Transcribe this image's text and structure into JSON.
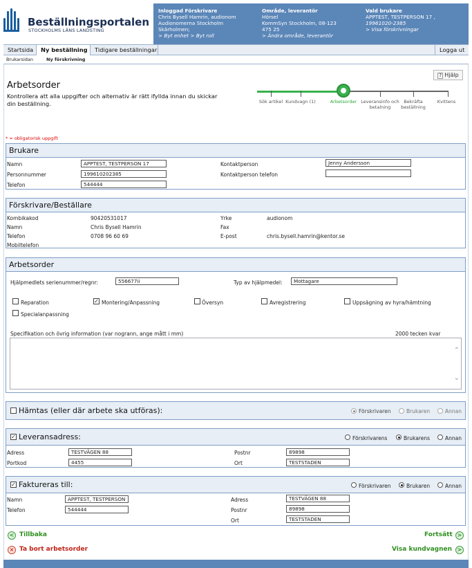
{
  "header": {
    "logo_title": "Beställningsportalen",
    "logo_subtitle": "STOCKHOLMS LÄNS LANDSTING",
    "logged_in": {
      "title": "Inloggad Förskrivare",
      "line1": "Chris Bysell Hamrin, audionom",
      "line2": "Audionomerna Stockholm",
      "line3": "Skärholmen;",
      "link": "> Byt enhet > Byt roll"
    },
    "area": {
      "title": "Område, leverantör",
      "line1": "Hörsel",
      "line2": "KommSyn Stockholm, 08-123",
      "line3": "475 25",
      "link": "> Ändra område, leverantör"
    },
    "user": {
      "title": "Vald brukare",
      "line1": "APPTEST, TESTPERSON 17 ,",
      "line2": "19961020-2385",
      "link": "> Visa förskrivningar"
    },
    "accent_color": "#5b86b8"
  },
  "nav": {
    "tabs": [
      "Startsida",
      "Ny beställning",
      "Tidigare beställningar"
    ],
    "logout": "Logga ut",
    "sub": [
      "Brukarsidan",
      "Ny förskrivning"
    ]
  },
  "page": {
    "help": "Hjälp",
    "title": "Arbetsorder",
    "description": "Kontrollera att alla uppgifter och alternativ är rätt ifyllda innan du skickar din beställning.",
    "required_note": "* = obligatorisk uppgift",
    "steps": [
      {
        "label": "Sök artikel"
      },
      {
        "label": "Kundvagn (1)"
      },
      {
        "label": "Arbetsorder"
      },
      {
        "label": "Leveransinfo och betalning"
      },
      {
        "label": "Bekräfta beställning"
      },
      {
        "label": "Kvittens"
      }
    ]
  },
  "brukare": {
    "heading": "Brukare",
    "name_label": "Namn",
    "name_value": "APPTEST, TESTPERSON 17",
    "pnr_label": "Personnummer",
    "pnr_value": "199610202385",
    "phone_label": "Telefon",
    "phone_value": "544444",
    "contact_label": "Kontaktperson",
    "contact_value": "Jenny Andersson",
    "contact_phone_label": "Kontaktperson telefon",
    "contact_phone_value": ""
  },
  "forskrivare": {
    "heading": "Förskrivare/Beställare",
    "kombi_label": "Kombikakod",
    "kombi_value": "90420531017",
    "name_label": "Namn",
    "name_value": "Chris Bysell Hamrin",
    "phone_label": "Telefon",
    "phone_value": "0708 96 60 69",
    "mobile_label": "Mobiltelefon",
    "yrke_label": "Yrke",
    "yrke_value": "audionom",
    "fax_label": "Fax",
    "email_label": "E-post",
    "email_value": "chris.bysell.hamrin@kentor.se"
  },
  "arbetsorder": {
    "heading": "Arbetsorder",
    "serial_label": "Hjälpmedlets serienummer/regnr:",
    "serial_value": "556677ii",
    "type_label": "Typ av hjälpmedel:",
    "type_value": "Mottagare",
    "options": [
      {
        "label": "Reparation",
        "checked": false
      },
      {
        "label": "Montering/Anpassning",
        "checked": true
      },
      {
        "label": "Översyn",
        "checked": false
      },
      {
        "label": "Avregistrering",
        "checked": false
      },
      {
        "label": "Uppsägning av hyra/hämtning",
        "checked": false
      },
      {
        "label": "Specialanpassning",
        "checked": false
      }
    ],
    "spec_label": "Specifikation och övrig information (var nogrann, ange mått i mm)",
    "spec_counter": "2000 tecken kvar"
  },
  "hamtas": {
    "heading": "Hämtas (eller där arbete ska utföras):",
    "checked": false,
    "radios": [
      "Förskrivaren",
      "Brukaren",
      "Annan"
    ],
    "selected": "Förskrivaren",
    "disabled": true
  },
  "leverans": {
    "heading": "Leveransadress:",
    "checked": true,
    "radios": [
      "Förskrivarens",
      "Brukarens",
      "Annan"
    ],
    "selected": "Brukarens",
    "address_label": "Adress",
    "address_value": "TESTVÄGEN 88",
    "portkod_label": "Portkod",
    "portkod_value": "4455",
    "postnr_label": "Postnr",
    "postnr_value": "89898",
    "ort_label": "Ort",
    "ort_value": "TESTSTADEN"
  },
  "faktura": {
    "heading": "Faktureras till:",
    "checked": true,
    "radios": [
      "Förskrivaren",
      "Brukaren",
      "Annan"
    ],
    "selected": "Brukaren",
    "name_label": "Namn",
    "name_value": "APPTEST, TESTPERSON",
    "phone_label": "Telefon",
    "phone_value": "544444",
    "address_label": "Adress",
    "address_value": "TESTVÄGEN 88",
    "postnr_label": "Postnr",
    "postnr_value": "89898",
    "ort_label": "Ort",
    "ort_value": "TESTSTADEN"
  },
  "footer": {
    "back": "Tillbaka",
    "delete": "Ta bort arbetsorder",
    "next": "Fortsätt",
    "cart": "Visa kundvagnen"
  }
}
